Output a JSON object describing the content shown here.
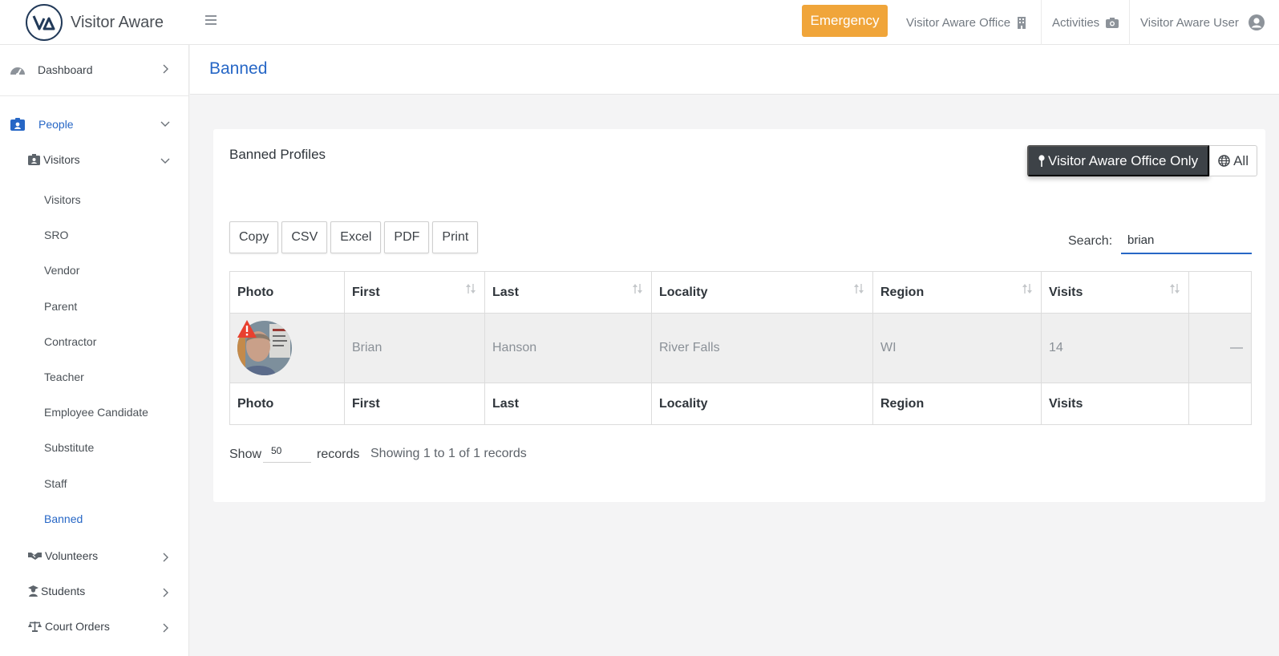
{
  "app": {
    "name": "Visitor Aware"
  },
  "topbar": {
    "emergency_label": "Emergency",
    "office_label": "Visitor Aware Office",
    "activities_label": "Activities",
    "user_label": "Visitor Aware User"
  },
  "sidebar": {
    "dashboard": "Dashboard",
    "people": "People",
    "visitors_group": "Visitors",
    "sub_items": [
      "Visitors",
      "SRO",
      "Vendor",
      "Parent",
      "Contractor",
      "Teacher",
      "Employee Candidate",
      "Substitute",
      "Staff",
      "Banned"
    ],
    "volunteers": "Volunteers",
    "students": "Students",
    "court_orders": "Court Orders"
  },
  "page": {
    "title": "Banned"
  },
  "card": {
    "title": "Banned Profiles",
    "scope_active": "Visitor Aware Office Only",
    "scope_all": "All",
    "export_buttons": [
      "Copy",
      "CSV",
      "Excel",
      "PDF",
      "Print"
    ],
    "search_label": "Search:",
    "search_value": "brian"
  },
  "table": {
    "columns": [
      "Photo",
      "First",
      "Last",
      "Locality",
      "Region",
      "Visits"
    ],
    "rows": [
      {
        "first": "Brian",
        "last": "Hanson",
        "locality": "River Falls",
        "region": "WI",
        "visits": "14",
        "action": "—"
      }
    ]
  },
  "footer": {
    "show_label": "Show",
    "page_length": "50",
    "records_label": "records",
    "info": "Showing 1 to 1 of 1 records"
  },
  "colors": {
    "accent": "#2767c6",
    "emergency": "#f0a53a",
    "dark_button": "#3d4247",
    "warning": "#e8402f"
  }
}
